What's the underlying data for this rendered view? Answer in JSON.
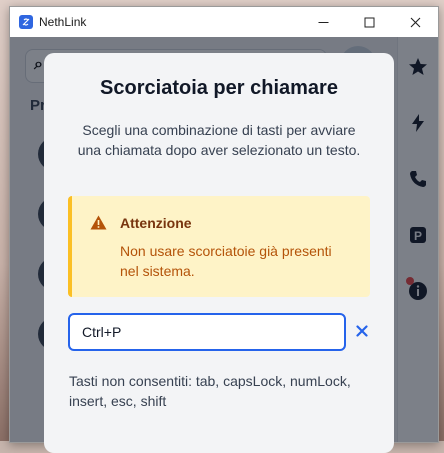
{
  "window": {
    "title": "NethLink"
  },
  "colors": {
    "accent": "#2563eb",
    "warning_border": "#fbbf24",
    "warning_bg": "#fef3c7",
    "warning_text": "#b45309"
  },
  "background_app": {
    "section_label": "Pr",
    "rail_icons": [
      "star-icon",
      "bolt-icon",
      "phone-icon",
      "parking-icon",
      "info-icon"
    ]
  },
  "modal": {
    "title": "Scorciatoia per chiamare",
    "description": "Scegli una combinazione di tasti per avviare una chiamata dopo aver selezionato un testo.",
    "alert": {
      "title": "Attenzione",
      "body": "Non usare scorciatoie già presenti nel sistema."
    },
    "shortcut_input": {
      "value": "Ctrl+P"
    },
    "disallowed_keys_text": "Tasti non consentiti: tab, capsLock, numLock, insert, esc, shift"
  }
}
